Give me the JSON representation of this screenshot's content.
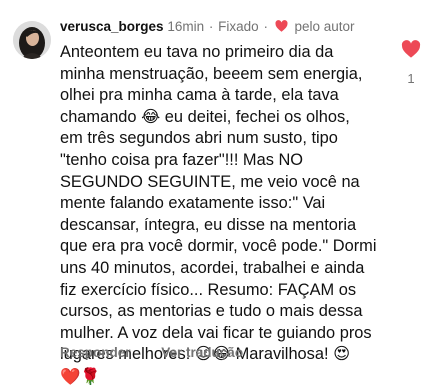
{
  "comment": {
    "username": "verusca_borges",
    "time": "16min",
    "separator": "·",
    "pinned": "Fixado",
    "separator2": "·",
    "liked_by_author": "pelo autor",
    "body_lines": [
      "Anteontem eu tava no primeiro dia da",
      "minha menstruação, beeem sem energia,",
      "olhei pra minha cama à tarde, ela tava",
      "chamando 😂 eu deitei, fechei os olhos,",
      "em três segundos abri num susto, tipo",
      "\"tenho coisa pra fazer\"!!! Mas NO",
      "SEGUNDO SEGUINTE, me veio você na",
      "mente falando exatamente isso:\" Vai",
      "descansar, íntegra, eu disse na mentoria",
      "que era pra você dormir, você pode.\" Dormi",
      "uns 40 minutos, acordei, trabalhei e ainda",
      "fiz exercício físico... Resumo: FAÇAM os",
      "cursos, as mentorias e tudo o mais dessa",
      "mulher. A voz dela vai ficar te guiando pros",
      "lugares melhores! 😉😂 Maravilhosa! 😍",
      "❤️🌹"
    ],
    "like_count": "1"
  },
  "actions": {
    "reply": "Responder",
    "translate": "Ver tradução"
  },
  "colors": {
    "like_red": "#ed4956",
    "muted": "#737373",
    "text": "#111111"
  },
  "icons": {
    "header_heart": "filled-heart-icon",
    "like_button": "filled-heart-icon"
  }
}
